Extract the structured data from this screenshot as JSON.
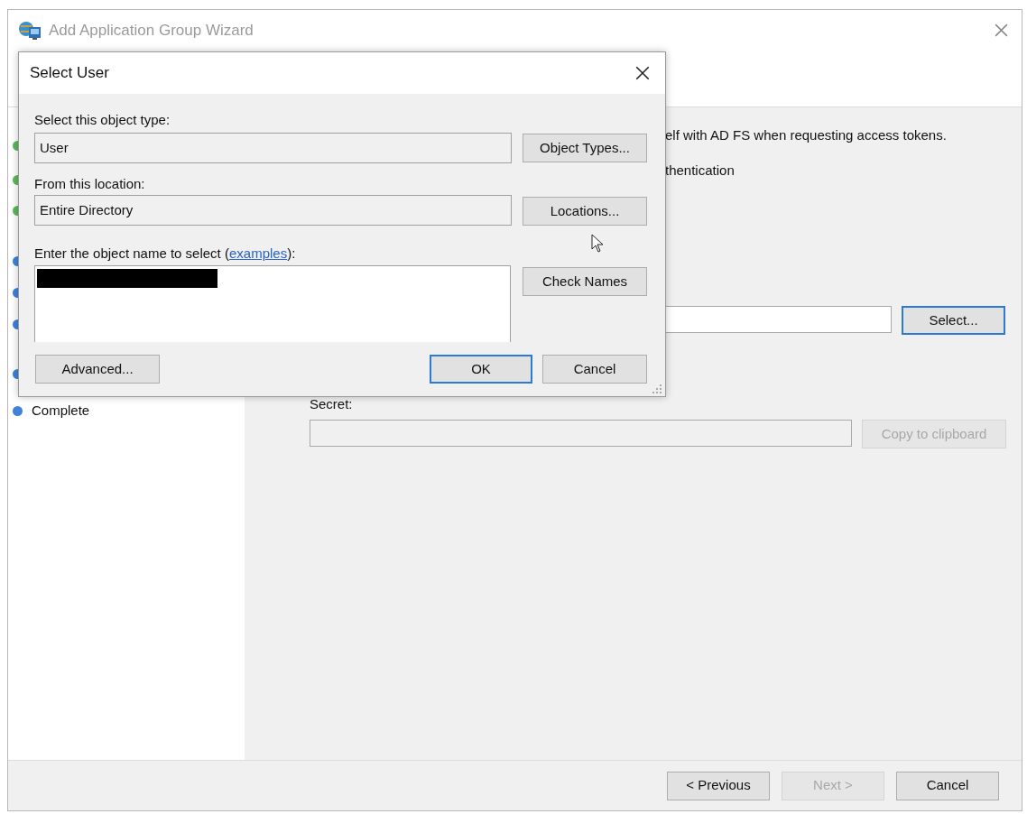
{
  "wizard": {
    "title": "Add Application Group Wizard",
    "steps": [
      {
        "color": "#5cb85c"
      },
      {
        "color": "#5cb85c"
      },
      {
        "color": "#5cb85c"
      },
      {
        "color": "#3f82d8"
      },
      {
        "color": "#3f82d8"
      },
      {
        "color": "#3f82d8"
      },
      {
        "color": "#3f82d8"
      },
      {
        "color": "#3f82d8",
        "label": "Complete"
      }
    ],
    "content": {
      "lines": [
        "elf with AD FS when requesting access tokens.",
        "thentication"
      ],
      "select_button": {
        "label": "Select...",
        "focused": true
      },
      "secret_label": "Secret:",
      "copy_button": {
        "label": "Copy to clipboard",
        "disabled": true
      }
    },
    "footer_buttons": [
      {
        "label": "< Previous",
        "disabled": false
      },
      {
        "label": "Next >",
        "disabled": true
      },
      {
        "label": "Cancel",
        "disabled": false
      }
    ]
  },
  "dialog": {
    "title": "Select User",
    "object_type_label": "Select this object type:",
    "object_type": "User",
    "object_types_button": "Object Types...",
    "location_label": "From this location:",
    "location": "Entire Directory",
    "locations_button": "Locations...",
    "name_label_before": "Enter the object name to select (",
    "name_label_link": "examples",
    "name_label_after": "):",
    "name_redacted": true,
    "check_names_button": "Check Names",
    "advanced_button": "Advanced...",
    "buttons": [
      {
        "label": "OK",
        "focused": true
      },
      {
        "label": "Cancel",
        "focused": false
      }
    ]
  }
}
